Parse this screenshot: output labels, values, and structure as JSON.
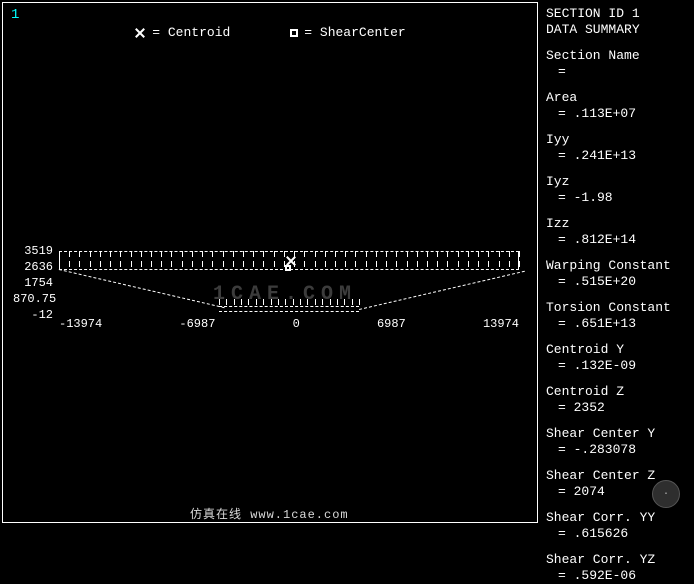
{
  "view": {
    "id": "1"
  },
  "legend": {
    "centroid_label": "= Centroid",
    "shear_label": "= ShearCenter"
  },
  "plot": {
    "y_ticks": [
      "3519",
      "2636",
      "1754",
      "870.75",
      "-12"
    ],
    "x_ticks": [
      "-13974",
      "-6987",
      "0",
      "6987",
      "13974"
    ]
  },
  "sidebar": {
    "header1": "SECTION ID 1",
    "header2": "DATA SUMMARY",
    "items": [
      {
        "label": "Section Name",
        "value": "="
      },
      {
        "label": "Area",
        "value": "= .113E+07"
      },
      {
        "label": "Iyy",
        "value": "= .241E+13"
      },
      {
        "label": "Iyz",
        "value": "= -1.98"
      },
      {
        "label": "Izz",
        "value": "= .812E+14"
      },
      {
        "label": "Warping Constant",
        "value": "= .515E+20"
      },
      {
        "label": "Torsion Constant",
        "value": "= .651E+13"
      },
      {
        "label": "Centroid Y",
        "value": "= .132E-09"
      },
      {
        "label": "Centroid Z",
        "value": "= 2352"
      },
      {
        "label": "Shear Center Y",
        "value": "= -.283078"
      },
      {
        "label": "Shear Center Z",
        "value": "= 2074"
      },
      {
        "label": "Shear Corr. YY",
        "value": "= .615626"
      },
      {
        "label": "Shear Corr. YZ",
        "value": "= .592E-06"
      }
    ]
  },
  "watermark": {
    "center": "1CAE.COM",
    "bottom": "仿真在线 www.1cae.com"
  }
}
